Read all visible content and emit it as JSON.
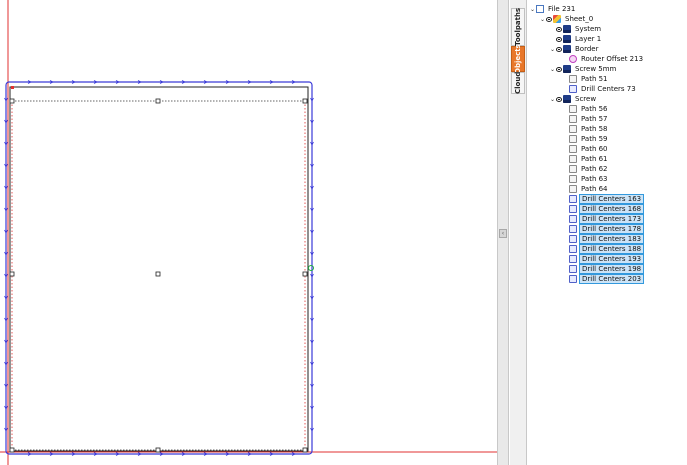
{
  "side_tabs": [
    {
      "label": "Toolpaths",
      "active": false
    },
    {
      "label": "Objects",
      "active": true
    },
    {
      "label": "Cloud",
      "active": false
    }
  ],
  "tree": {
    "file": {
      "label": "File 231",
      "icon": "file-icon"
    },
    "sheet": {
      "label": "Sheet_0",
      "icon": "sheet-icon"
    },
    "layers": [
      {
        "key": "system",
        "label": "System",
        "expanded": false,
        "children": []
      },
      {
        "key": "layer1",
        "label": "Layer 1",
        "expanded": false,
        "children": []
      },
      {
        "key": "border",
        "label": "Border",
        "expanded": true,
        "children": [
          {
            "label": "Router Offset 213",
            "kind": "router",
            "selected": false
          }
        ]
      },
      {
        "key": "screw5mm",
        "label": "Screw 5mm",
        "expanded": true,
        "children": [
          {
            "label": "Path 51",
            "kind": "path",
            "selected": false
          },
          {
            "label": "Drill Centers 73",
            "kind": "drill",
            "selected": false
          }
        ]
      },
      {
        "key": "screw",
        "label": "Screw",
        "expanded": true,
        "children": [
          {
            "label": "Path 56",
            "kind": "path",
            "selected": false
          },
          {
            "label": "Path 57",
            "kind": "path",
            "selected": false
          },
          {
            "label": "Path 58",
            "kind": "path",
            "selected": false
          },
          {
            "label": "Path 59",
            "kind": "path",
            "selected": false
          },
          {
            "label": "Path 60",
            "kind": "path",
            "selected": false
          },
          {
            "label": "Path 61",
            "kind": "path",
            "selected": false
          },
          {
            "label": "Path 62",
            "kind": "path",
            "selected": false
          },
          {
            "label": "Path 63",
            "kind": "path",
            "selected": false
          },
          {
            "label": "Path 64",
            "kind": "path",
            "selected": false
          },
          {
            "label": "Drill Centers 163",
            "kind": "drill",
            "selected": true
          },
          {
            "label": "Drill Centers 168",
            "kind": "drill",
            "selected": true
          },
          {
            "label": "Drill Centers 173",
            "kind": "drill",
            "selected": true
          },
          {
            "label": "Drill Centers 178",
            "kind": "drill",
            "selected": true
          },
          {
            "label": "Drill Centers 183",
            "kind": "drill",
            "selected": true
          },
          {
            "label": "Drill Centers 188",
            "kind": "drill",
            "selected": true
          },
          {
            "label": "Drill Centers 193",
            "kind": "drill",
            "selected": true
          },
          {
            "label": "Drill Centers 198",
            "kind": "drill",
            "selected": true
          },
          {
            "label": "Drill Centers 203",
            "kind": "drill",
            "selected": true
          }
        ]
      }
    ]
  },
  "colors": {
    "axis": "#e03030",
    "toolpath": "#3a3ad8",
    "sheet_outline": "#222222",
    "selection_accent": "#3399dd",
    "active_tab": "#e8772a"
  }
}
